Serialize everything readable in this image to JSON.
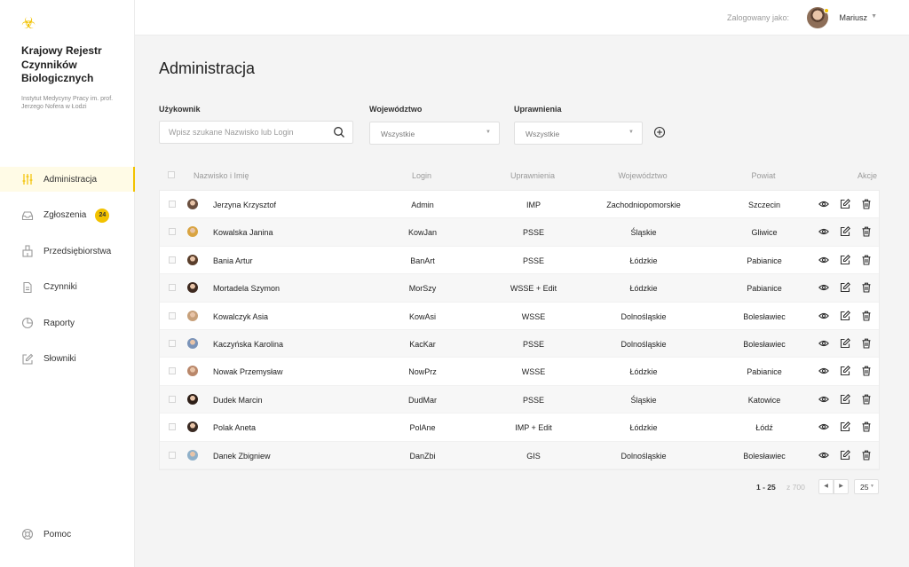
{
  "colors": {
    "accent": "#f2c200",
    "sidebar_bg": "#ffffff",
    "page_bg": "#f4f4f4"
  },
  "sidebar": {
    "logo_icon": "biohazard-icon",
    "title": "Krajowy Rejestr Czynników Biologicznych",
    "subtitle": "Instytut Medycyny Pracy im. prof. Jerzego Nofera w Łodzi",
    "items": [
      {
        "label": "Administracja",
        "icon": "sliders-icon",
        "active": true
      },
      {
        "label": "Zgłoszenia",
        "icon": "inbox-icon",
        "badge": "24"
      },
      {
        "label": "Przedsiębiorstwa",
        "icon": "building-icon"
      },
      {
        "label": "Czynniki",
        "icon": "document-icon"
      },
      {
        "label": "Raporty",
        "icon": "pie-chart-icon"
      },
      {
        "label": "Słowniki",
        "icon": "edit-icon"
      }
    ],
    "help": {
      "label": "Pomoc",
      "icon": "lifebuoy-icon"
    }
  },
  "header": {
    "logged_as": "Zalogowany jako:",
    "user_name": "Mariusz"
  },
  "main": {
    "title": "Administracja",
    "filters": {
      "user_label": "Użykownik",
      "search_placeholder": "Wpisz szukane Nazwisko lub Login",
      "voivodeship_label": "Województwo",
      "voivodeship_value": "Wszystkie",
      "permissions_label": "Uprawnienia",
      "permissions_value": "Wszystkie"
    },
    "table": {
      "columns": [
        "Nazwisko i Imię",
        "Login",
        "Uprawnienia",
        "Województwo",
        "Powiat",
        "Akcje"
      ],
      "rows": [
        {
          "name": "Jerzyna Krzysztof",
          "login": "Admin",
          "perm": "IMP",
          "voiv": "Zachodniopomorskie",
          "county": "Szczecin"
        },
        {
          "name": "Kowalska Janina",
          "login": "KowJan",
          "perm": "PSSE",
          "voiv": "Śląskie",
          "county": "Gliwice"
        },
        {
          "name": "Bania Artur",
          "login": "BanArt",
          "perm": "PSSE",
          "voiv": "Łódzkie",
          "county": "Pabianice"
        },
        {
          "name": "Mortadela Szymon",
          "login": "MorSzy",
          "perm": "WSSE + Edit",
          "voiv": "Łódzkie",
          "county": "Pabianice"
        },
        {
          "name": "Kowalczyk Asia",
          "login": "KowAsi",
          "perm": "WSSE",
          "voiv": "Dolnośląskie",
          "county": "Bolesławiec"
        },
        {
          "name": "Kaczyńska Karolina",
          "login": "KacKar",
          "perm": "PSSE",
          "voiv": "Dolnośląskie",
          "county": "Bolesławiec"
        },
        {
          "name": "Nowak Przemysław",
          "login": "NowPrz",
          "perm": "WSSE",
          "voiv": "Łódzkie",
          "county": "Pabianice"
        },
        {
          "name": "Dudek Marcin",
          "login": "DudMar",
          "perm": "PSSE",
          "voiv": "Śląskie",
          "county": "Katowice"
        },
        {
          "name": "Polak Aneta",
          "login": "PolAne",
          "perm": "IMP + Edit",
          "voiv": "Łódzkie",
          "county": "Łódź"
        },
        {
          "name": "Danek Zbigniew",
          "login": "DanZbi",
          "perm": "GIS",
          "voiv": "Dolnośląskie",
          "county": "Bolesławiec"
        }
      ],
      "row_actions": [
        "eye-icon",
        "edit-icon",
        "trash-icon"
      ]
    },
    "pagination": {
      "range": "1 - 25",
      "total": "z 700",
      "page_size": "25"
    }
  }
}
